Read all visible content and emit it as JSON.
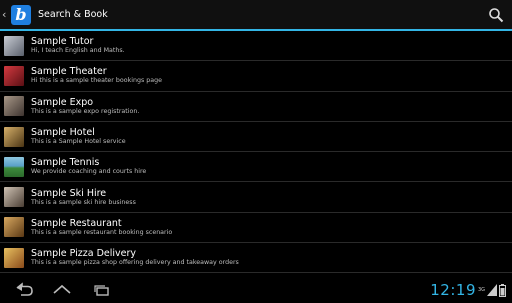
{
  "action_bar": {
    "title": "Search & Book",
    "logo_letter": "b"
  },
  "list": {
    "items": [
      {
        "title": "Sample Tutor",
        "subtitle": "Hi, I teach English and Maths.",
        "thumb_color": "#8a8f9a"
      },
      {
        "title": "Sample Theater",
        "subtitle": "Hi this is a sample theater bookings page",
        "thumb_color": "#b2242c"
      },
      {
        "title": "Sample Expo",
        "subtitle": "This is a sample expo registration.",
        "thumb_color": "#7a6a58"
      },
      {
        "title": "Sample Hotel",
        "subtitle": "This is a Sample Hotel service",
        "thumb_color": "#9c7a3c"
      },
      {
        "title": "Sample Tennis",
        "subtitle": "We provide coaching and courts hire",
        "thumb_color": "#4c8a9c"
      },
      {
        "title": "Sample Ski Hire",
        "subtitle": "This is a sample ski hire business",
        "thumb_color": "#8c7d6c"
      },
      {
        "title": "Sample Restaurant",
        "subtitle": "This is a sample restaurant booking scenario",
        "thumb_color": "#a07840"
      },
      {
        "title": "Sample Pizza Delivery",
        "subtitle": "This is a sample pizza shop offering delivery and takeaway orders",
        "thumb_color": "#b08a3a"
      }
    ]
  },
  "status": {
    "clock": "12:19",
    "network": "3G"
  },
  "colors": {
    "accent": "#33b5e5",
    "logo_bg": "#1f7fe0"
  }
}
